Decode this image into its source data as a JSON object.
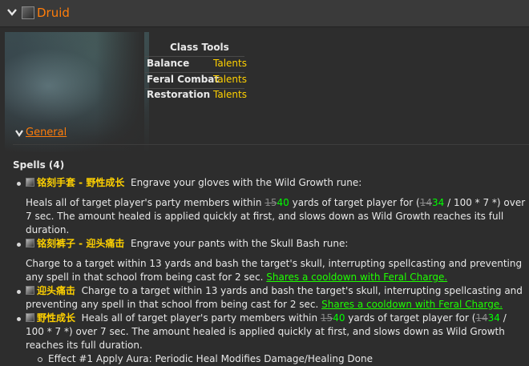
{
  "header": {
    "title": "Druid"
  },
  "class_tools": {
    "title": "Class Tools",
    "rows": [
      {
        "spec": "Balance",
        "link": "Talents"
      },
      {
        "spec": "Feral Combat",
        "link": "Talents"
      },
      {
        "spec": "Restoration",
        "link": "Talents"
      }
    ]
  },
  "section": {
    "title": "General"
  },
  "spells_heading": "Spells (4)",
  "spells": [
    {
      "name": "铭刻手套 - 野性成长",
      "summary": "Engrave your gloves with the Wild Growth rune:",
      "desc": {
        "t1": "Heals all of target player's party members within ",
        "old1": "15",
        "new1": "40",
        "t2": " yards of target player for (",
        "old2": "14",
        "new2": "34",
        "t3": " / 100 * 7 *) over 7 sec. The amount healed is applied quickly at first, and slows down as Wild Growth reaches its full duration."
      }
    },
    {
      "name": "铭刻裤子 - 迎头痛击",
      "summary": "Engrave your pants with the Skull Bash rune:",
      "desc": {
        "t1": "Charge to a target within 13 yards and bash the target's skull, interrupting spellcasting and preventing any spell in that school from being cast for 2 sec. ",
        "link": "Shares a cooldown with Feral Charge."
      }
    },
    {
      "name": "迎头痛击",
      "text": "Charge to a target within 13 yards and bash the target's skull, interrupting spellcasting and preventing any spell in that school from being cast for 2 sec. ",
      "link": "Shares a cooldown with Feral Charge."
    },
    {
      "name": "野性成长",
      "t1": "Heals all of target player's party members within ",
      "old1": "15",
      "new1": "40",
      "t2": " yards of target player for (",
      "old2": "14",
      "new2": "34",
      "t3": " / 100 * 7 *) over 7 sec. The amount healed is applied quickly at first, and slows down as Wild Growth reaches its full duration.",
      "effects": [
        "Effect #1 Apply Aura: Periodic Heal Modifies Damage/Healing Done"
      ]
    }
  ],
  "colors": {
    "class_orange": "#ff7d0a",
    "gold": "#ffd100",
    "green": "#1eff00"
  }
}
